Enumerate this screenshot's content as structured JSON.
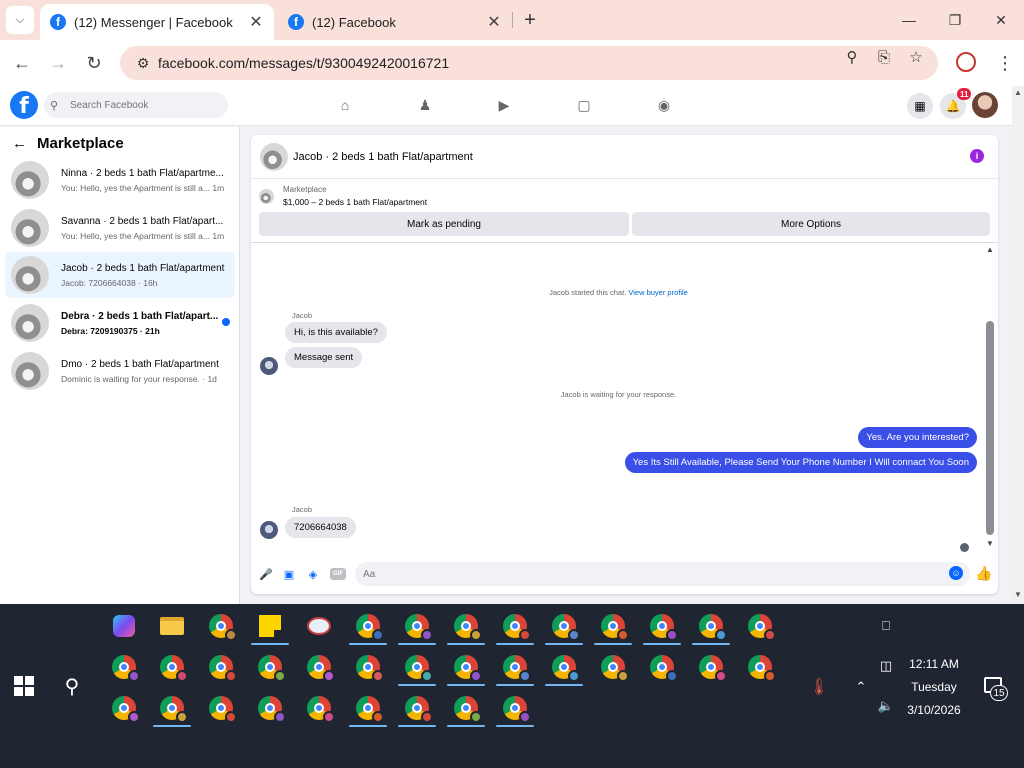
{
  "browser": {
    "tabs": [
      {
        "title": "(12) Messenger | Facebook",
        "active": true
      },
      {
        "title": "(12) Facebook",
        "active": false
      }
    ],
    "url": "facebook.com/messages/t/9300492420016721"
  },
  "fb": {
    "search_placeholder": "Search Facebook",
    "notification_count": "11"
  },
  "sidebar": {
    "title": "Marketplace",
    "conversations": [
      {
        "name": "Ninna · 2 beds 1 bath Flat/apartme...",
        "preview": "You: Hello, yes the Apartment is still a... 1m"
      },
      {
        "name": "Savanna · 2 beds 1 bath Flat/apart...",
        "preview": "You: Hello, yes the Apartment is still a... 1m"
      },
      {
        "name": "Jacob · 2 beds 1 bath Flat/apartment",
        "preview": "Jacob: 7206664038 · 16h"
      },
      {
        "name": "Debra · 2 beds 1 bath Flat/apart...",
        "preview": "Debra: 7209190375 · 21h"
      },
      {
        "name": "Dmo · 2 beds 1 bath Flat/apartment",
        "preview": "Dominic is waiting for your response. · 1d"
      }
    ]
  },
  "chat": {
    "title": "Jacob · 2 beds 1 bath Flat/apartment",
    "listing_source": "Marketplace",
    "listing_title": "$1,000 – 2 beds 1 bath Flat/apartment",
    "mark_pending_label": "Mark as pending",
    "more_options_label": "More Options",
    "started_text": "Jacob started this chat.",
    "view_profile_link": "View buyer profile",
    "sender_name_1": "Jacob",
    "msg_in_1": "Hi, is this available?",
    "msg_in_2": "Message sent",
    "waiting_text": "Jacob is waiting for your response.",
    "msg_out_1": "Yes. Are you interested?",
    "msg_out_2": "Yes Its Still Available, Please Send Your Phone Number I Will connact You Soon",
    "sender_name_2": "Jacob",
    "msg_in_3": "7206664038",
    "composer_placeholder": "Aa",
    "gif_label": "GIF"
  },
  "taskbar": {
    "time": "12:11 AM",
    "day": "Tuesday",
    "date": "3/10/2026",
    "notification_count": "15"
  },
  "colors": {
    "fb_blue": "#1877f2",
    "outgoing_bubble": "#3a4fe8",
    "selected_conversation": "#ebf5ff",
    "tabstrip": "#f9e0db",
    "taskbar": "#1f2631"
  }
}
